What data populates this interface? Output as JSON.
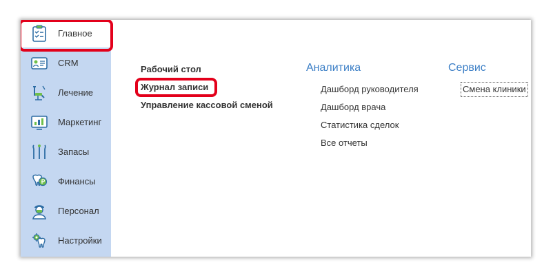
{
  "sidebar": {
    "items": [
      {
        "label": "Главное",
        "icon": "clipboard-checklist-icon",
        "active": true
      },
      {
        "label": "CRM",
        "icon": "contact-card-icon"
      },
      {
        "label": "Лечение",
        "icon": "dental-chair-icon"
      },
      {
        "label": "Маркетинг",
        "icon": "chart-monitor-icon"
      },
      {
        "label": "Запасы",
        "icon": "dental-tools-icon"
      },
      {
        "label": "Финансы",
        "icon": "tooth-coin-icon"
      },
      {
        "label": "Персонал",
        "icon": "doctor-icon"
      },
      {
        "label": "Настройки",
        "icon": "tooth-gear-icon"
      }
    ]
  },
  "main": {
    "links": [
      "Рабочий стол",
      "Журнал записи",
      "Управление кассовой сменой"
    ]
  },
  "analytics": {
    "title": "Аналитика",
    "links": [
      "Дашборд руководителя",
      "Дашборд врача",
      "Статистика сделок",
      "Все отчеты"
    ]
  },
  "service": {
    "title": "Сервис",
    "button": "Смена клиники"
  },
  "colors": {
    "sidebar_bg": "#c4d7f1",
    "section_title": "#3c7fc6",
    "highlight_red": "#e3001b",
    "icon_stroke": "#2e6da4",
    "icon_accent": "#6fbf4a"
  }
}
